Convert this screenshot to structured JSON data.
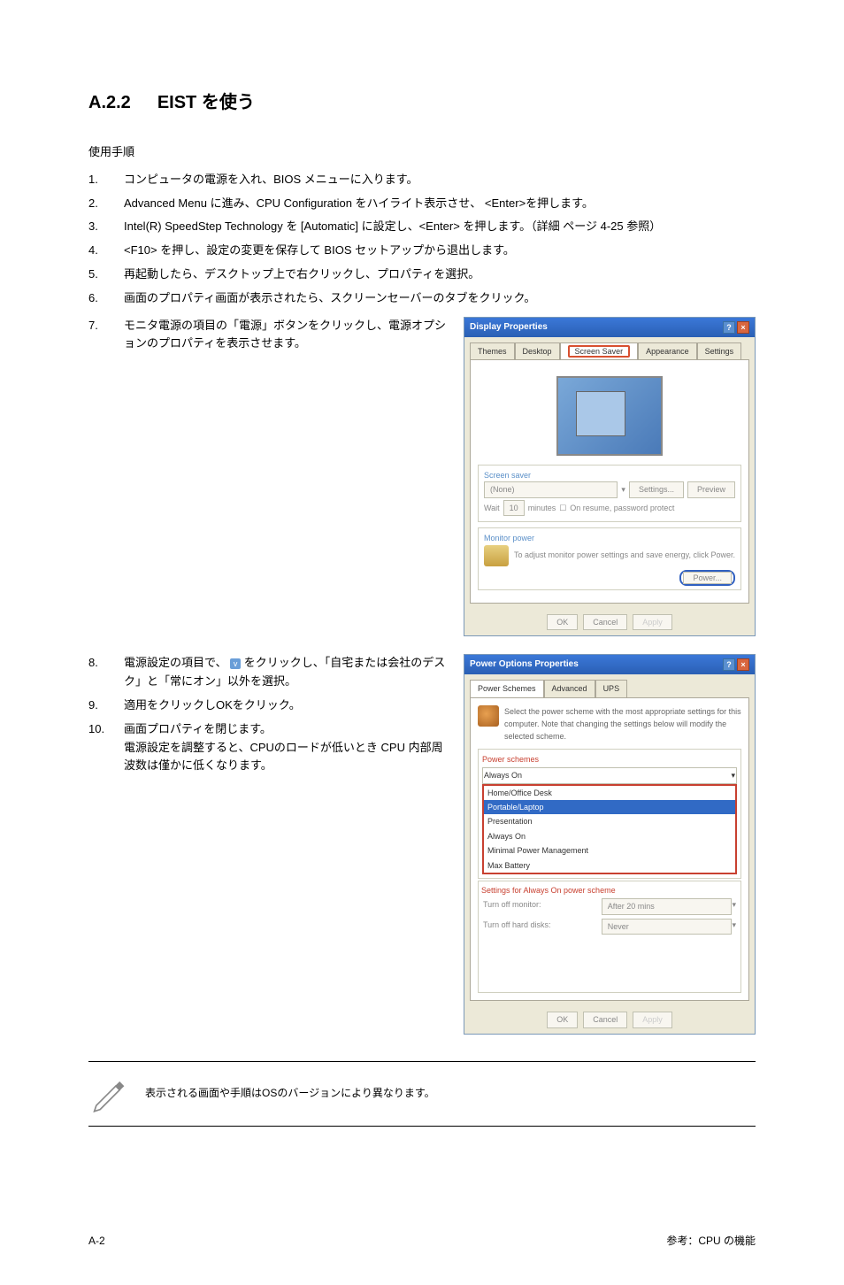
{
  "section": {
    "number": "A.2.2",
    "title": "EIST を使う"
  },
  "subheading": "使用手順",
  "steps": [
    {
      "n": "1.",
      "t": "コンピュータの電源を入れ、BIOS メニューに入ります。"
    },
    {
      "n": "2.",
      "t": "Advanced Menu に進み、CPU Configuration をハイライト表示させ、 <Enter>を押します。"
    },
    {
      "n": "3.",
      "t": "Intel(R) SpeedStep Technology を [Automatic] に設定し、<Enter> を押します。（詳細 ページ 4-25 参照）"
    },
    {
      "n": "4.",
      "t": "<F10> を押し、設定の変更を保存して BIOS セットアップから退出します。"
    },
    {
      "n": "5.",
      "t": "再起動したら、デスクトップ上で右クリックし、プロパティを選択。"
    },
    {
      "n": "6.",
      "t": "画面のプロパティ画面が表示されたら、スクリーンセーバーのタブをクリック。"
    },
    {
      "n": "7.",
      "t": "モニタ電源の項目の「電源」ボタンをクリックし、電源オプションのプロパティを表示させます。"
    }
  ],
  "steps2": [
    {
      "n": "8.",
      "pre": "電源設定の項目で、",
      "post": "をクリックし、「自宅または会社のデスク」と「常にオン」以外を選択。"
    },
    {
      "n": "9.",
      "t": "適用をクリックしOKをクリック。"
    },
    {
      "n": "10.",
      "t": "画面プロパティを閉じます。"
    }
  ],
  "extra_para": "電源設定を調整すると、CPUのロードが低いとき CPU 内部周波数は僅かに低くなります。",
  "dialog1": {
    "title": "Display Properties",
    "tabs": {
      "themes": "Themes",
      "desktop": "Desktop",
      "screensaver": "Screen Saver",
      "appearance": "Appearance",
      "settings": "Settings"
    },
    "screensaver_label": "Screen saver",
    "none": "(None)",
    "settings_btn": "Settings...",
    "preview_btn": "Preview",
    "wait": "Wait",
    "min": "minutes",
    "resume": "On resume, password protect",
    "monitor_label": "Monitor power",
    "monitor_text": "To adjust monitor power settings and save energy, click Power.",
    "power_btn": "Power...",
    "ok": "OK",
    "cancel": "Cancel",
    "apply": "Apply"
  },
  "dialog2": {
    "title": "Power Options Properties",
    "tabs": {
      "schemes": "Power Schemes",
      "advanced": "Advanced",
      "ups": "UPS"
    },
    "desc": "Select the power scheme with the most appropriate settings for this computer. Note that changing the settings below will modify the selected scheme.",
    "schemes_label": "Power schemes",
    "selected": "Always On",
    "dropdown_items": [
      "Home/Office Desk",
      "Portable/Laptop",
      "Presentation",
      "Always On",
      "Minimal Power Management",
      "Max Battery"
    ],
    "settings_label_pre": "Settings for ",
    "settings_label_post": " power scheme",
    "turn_monitor": "Turn off monitor:",
    "turn_monitor_val": "After 20 mins",
    "turn_disks": "Turn off hard disks:",
    "turn_disks_val": "Never",
    "ok": "OK",
    "cancel": "Cancel",
    "apply": "Apply"
  },
  "note": "表示される画面や手順はOSのバージョンにより異なります。",
  "footer": {
    "left": "A-2",
    "right": "参考：CPU の機能"
  }
}
